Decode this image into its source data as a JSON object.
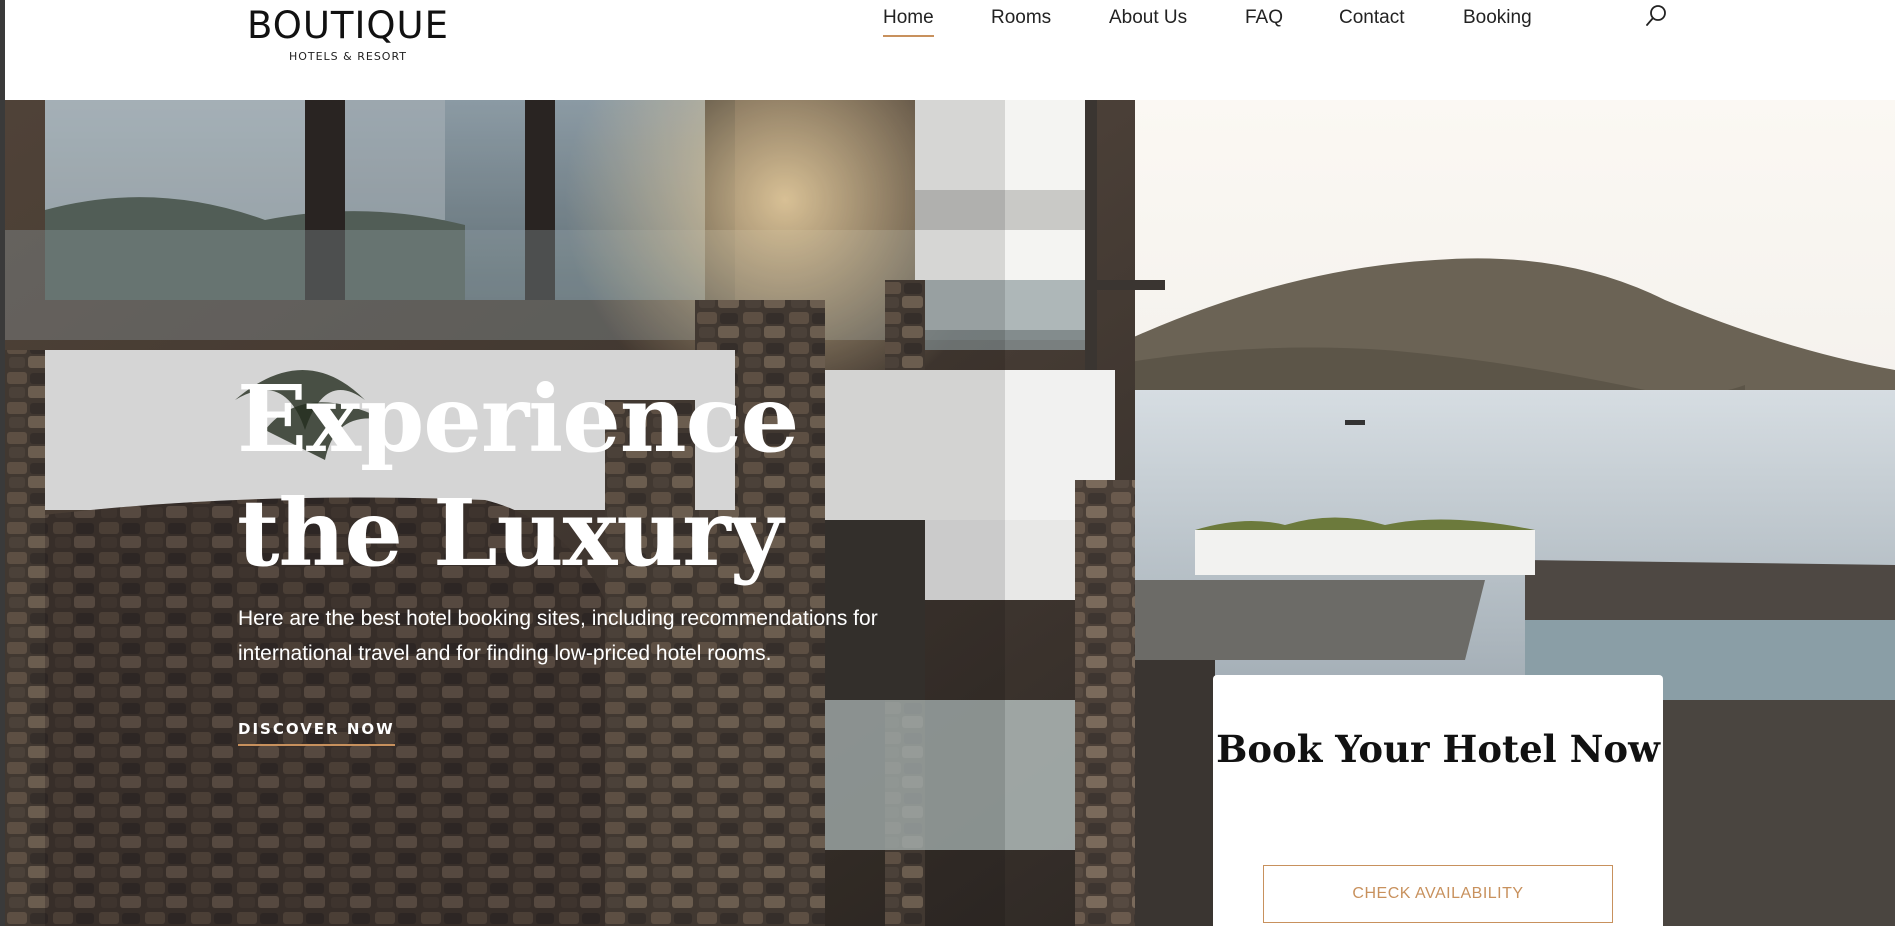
{
  "brand": {
    "name": "BOUTIQUE",
    "tagline": "HOTELS & RESORT"
  },
  "nav": {
    "items": [
      {
        "label": "Home",
        "active": true
      },
      {
        "label": "Rooms",
        "active": false
      },
      {
        "label": "About Us",
        "active": false
      },
      {
        "label": "FAQ",
        "active": false
      },
      {
        "label": "Contact",
        "active": false
      },
      {
        "label": "Booking",
        "active": false
      }
    ],
    "search_icon": "search-icon"
  },
  "hero": {
    "title_line1": "Experience",
    "title_line2": "the Luxury",
    "description": "Here are the best hotel booking sites, including recommendations for international travel and for finding low-priced hotel rooms.",
    "cta_label": "DISCOVER NOW"
  },
  "booking": {
    "title": "Book Your Hotel Now",
    "button_label": "CHECK AVAILABILITY"
  },
  "colors": {
    "accent": "#c8915d",
    "header_bg": "#ffffff",
    "text_dark": "#111111"
  }
}
